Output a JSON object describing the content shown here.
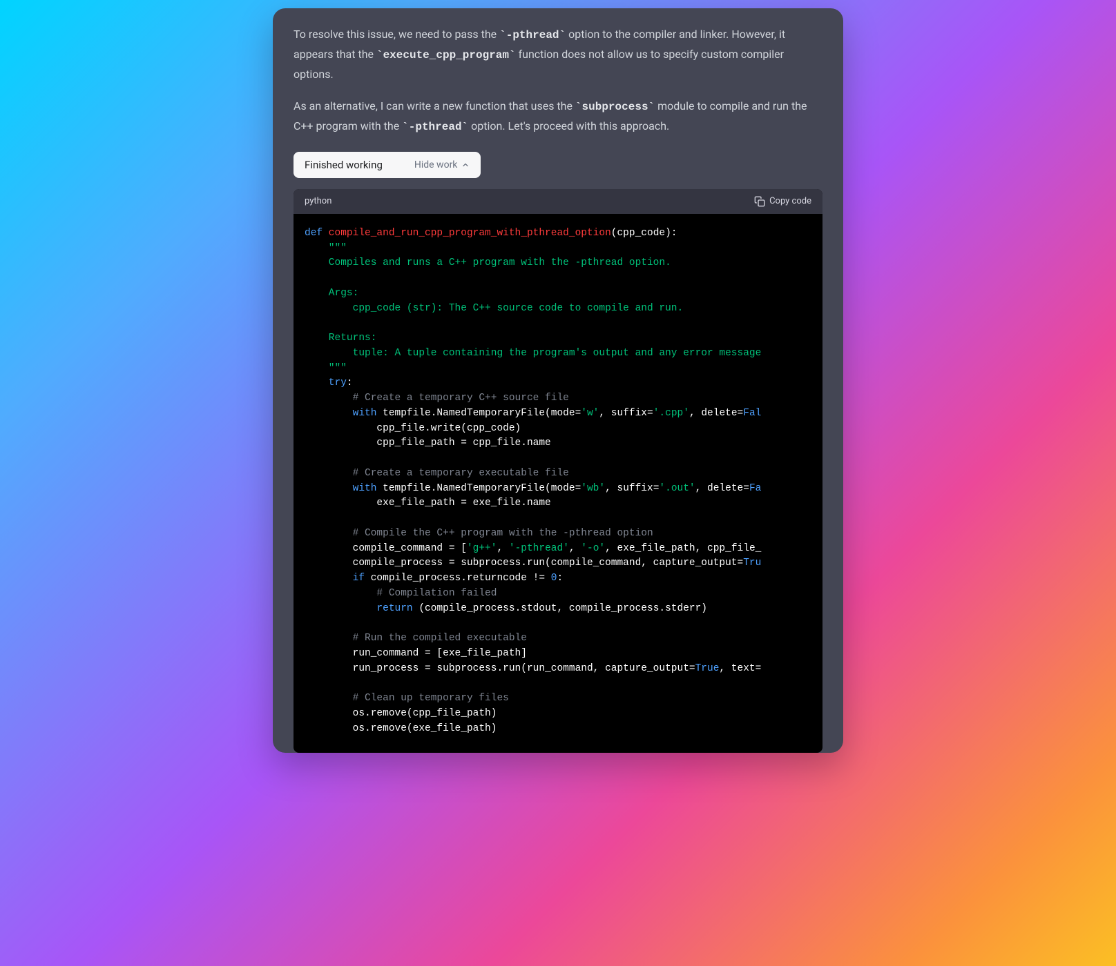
{
  "message": {
    "p1_a": "To resolve this issue, we need to pass the ",
    "p1_code1": "`-pthread`",
    "p1_b": " option to the compiler and linker. However, it appears that the ",
    "p1_code2": "`execute_cpp_program`",
    "p1_c": " function does not allow us to specify custom compiler options.",
    "p2_a": "As an alternative, I can write a new function that uses the ",
    "p2_code1": "`subprocess`",
    "p2_b": " module to compile and run the C++ program with the ",
    "p2_code2": "`-pthread`",
    "p2_c": " option. Let's proceed with this approach."
  },
  "work_pill": {
    "status": "Finished working",
    "toggle": "Hide work"
  },
  "code": {
    "language": "python",
    "copy_label": "Copy code",
    "lines": {
      "l01_def": "def",
      "l01_fn": " compile_and_run_cpp_program_with_pthread_option",
      "l01_rest": "(cpp_code):",
      "l02": "    \"\"\"",
      "l03": "    Compiles and runs a C++ program with the -pthread option.",
      "l04": "",
      "l05": "    Args:",
      "l06": "        cpp_code (str): The C++ source code to compile and run.",
      "l07": "",
      "l08": "    Returns:",
      "l09": "        tuple: A tuple containing the program's output and any error message",
      "l10": "    \"\"\"",
      "l11_try": "    try",
      "l11_colon": ":",
      "l12_com": "        # Create a temporary C++ source file",
      "l13_with": "        with",
      "l13_mid": " tempfile.NamedTemporaryFile(mode=",
      "l13_s1": "'w'",
      "l13_c1": ", suffix=",
      "l13_s2": "'.cpp'",
      "l13_c2": ", delete=",
      "l13_false": "Fal",
      "l14": "            cpp_file.write(cpp_code)",
      "l15": "            cpp_file_path = cpp_file.name",
      "l16": "",
      "l17_com": "        # Create a temporary executable file",
      "l18_with": "        with",
      "l18_mid": " tempfile.NamedTemporaryFile(mode=",
      "l18_s1": "'wb'",
      "l18_c1": ", suffix=",
      "l18_s2": "'.out'",
      "l18_c2": ", delete=",
      "l18_false": "Fa",
      "l19": "            exe_file_path = exe_file.name",
      "l20": "",
      "l21_com": "        # Compile the C++ program with the -pthread option",
      "l22_a": "        compile_command = [",
      "l22_s1": "'g++'",
      "l22_c1": ", ",
      "l22_s2": "'-pthread'",
      "l22_c2": ", ",
      "l22_s3": "'-o'",
      "l22_c3": ", exe_file_path, cpp_file_",
      "l23_a": "        compile_process = subprocess.run(compile_command, capture_output=",
      "l23_true": "Tru",
      "l24_if": "        if",
      "l24_mid": " compile_process.returncode != ",
      "l24_zero": "0",
      "l24_colon": ":",
      "l25_com": "            # Compilation failed",
      "l26_ret": "            return",
      "l26_rest": " (compile_process.stdout, compile_process.stderr)",
      "l27": "",
      "l28_com": "        # Run the compiled executable",
      "l29": "        run_command = [exe_file_path]",
      "l30_a": "        run_process = subprocess.run(run_command, capture_output=",
      "l30_true": "True",
      "l30_c1": ", text=",
      "l31": "",
      "l32_com": "        # Clean up temporary files",
      "l33": "        os.remove(cpp_file_path)",
      "l34": "        os.remove(exe_file_path)"
    }
  }
}
